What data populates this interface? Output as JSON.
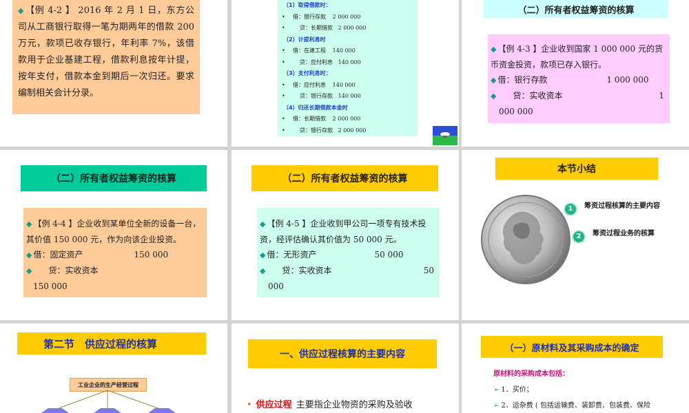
{
  "slide1": {
    "example_text": "【例 4-2 】 2016 年 2 月 1 日，东方公司从工商银行取得一笔为期两年的借款 200 万元，款项已收存银行，年利率 7%，该借款用于企业基建工程，借款利息按年计提，按年支付，借款本金到期后一次归还。要求编制相关会计分录。"
  },
  "slide2": {
    "sections": [
      {
        "heading": "（1）取得借款时：",
        "lines": [
          {
            "debit": "借：银行存款",
            "amount": "2 000 000"
          },
          {
            "credit": "贷：长期借款",
            "amount": "2 000 000"
          }
        ]
      },
      {
        "heading": "（2）计提利息时",
        "lines": [
          {
            "debit": "借：在建工程",
            "amount": "140 000"
          },
          {
            "credit": "贷：应付利息",
            "amount": "140 000"
          }
        ]
      },
      {
        "heading": "（3）支付利息时：",
        "lines": [
          {
            "debit": "借：应付利息",
            "amount": "140 000"
          },
          {
            "credit": "贷：银行存款",
            "amount": "140 000"
          }
        ]
      },
      {
        "heading": "（4）归还长期借款本金时",
        "lines": [
          {
            "debit": "借：长期借款",
            "amount": "2 000 000"
          },
          {
            "credit": "贷：银行存款",
            "amount": "2 000 000"
          }
        ]
      }
    ]
  },
  "slide3": {
    "title": "（二）所有者权益筹资的核算",
    "example": "【例 4-3 】企业收到国家 1 000 000 元的货币资金投资，款项已存入银行。",
    "debit": "借：银行存款",
    "debit_amount": "1 000 000",
    "credit": "贷：实收资本",
    "credit_amount_a": "1",
    "credit_amount_b": "000 000"
  },
  "slide4": {
    "title": "（二）所有者权益筹资的核算",
    "example": "【例 4-4 】企业收到某单位全新的设备一台，其价值 150 000 元，作为向该企业投资。",
    "debit": "借：固定资产",
    "debit_amount": "150 000",
    "credit": "贷：实收资本",
    "credit_amount": "150 000"
  },
  "slide5": {
    "title": "（二）所有者权益筹资的核算",
    "example": "【例 4-5 】企业收到甲公司一项专有技术投资，经评估确认其价值为 50 000 元。",
    "debit": "借：无形资产",
    "debit_amount": "50 000",
    "credit": "贷：实收资本",
    "credit_amount_a": "50",
    "credit_amount_b": "000"
  },
  "slide6": {
    "title": "本节小结",
    "items": [
      {
        "num": "1",
        "text": "筹资过程核算的主要内容"
      },
      {
        "num": "2",
        "text": "筹资过程业务的核算"
      }
    ]
  },
  "slide7": {
    "title": "第二节　供应过程的核算",
    "flow_label": "工业企业的生产经营过程"
  },
  "slide8": {
    "title": "一、供应过程核算的主要内容",
    "bullet_key": "供应过程",
    "bullet_text": "主要指企业物资的采购及验收"
  },
  "slide9": {
    "title": "（一）原材料及其采购成本的确定",
    "subtitle": "原材料的采购成本包括：",
    "line1": "1．买价；",
    "line2": "2．运杂费 ( 包括运输费、装卸费、包装费、保险"
  }
}
